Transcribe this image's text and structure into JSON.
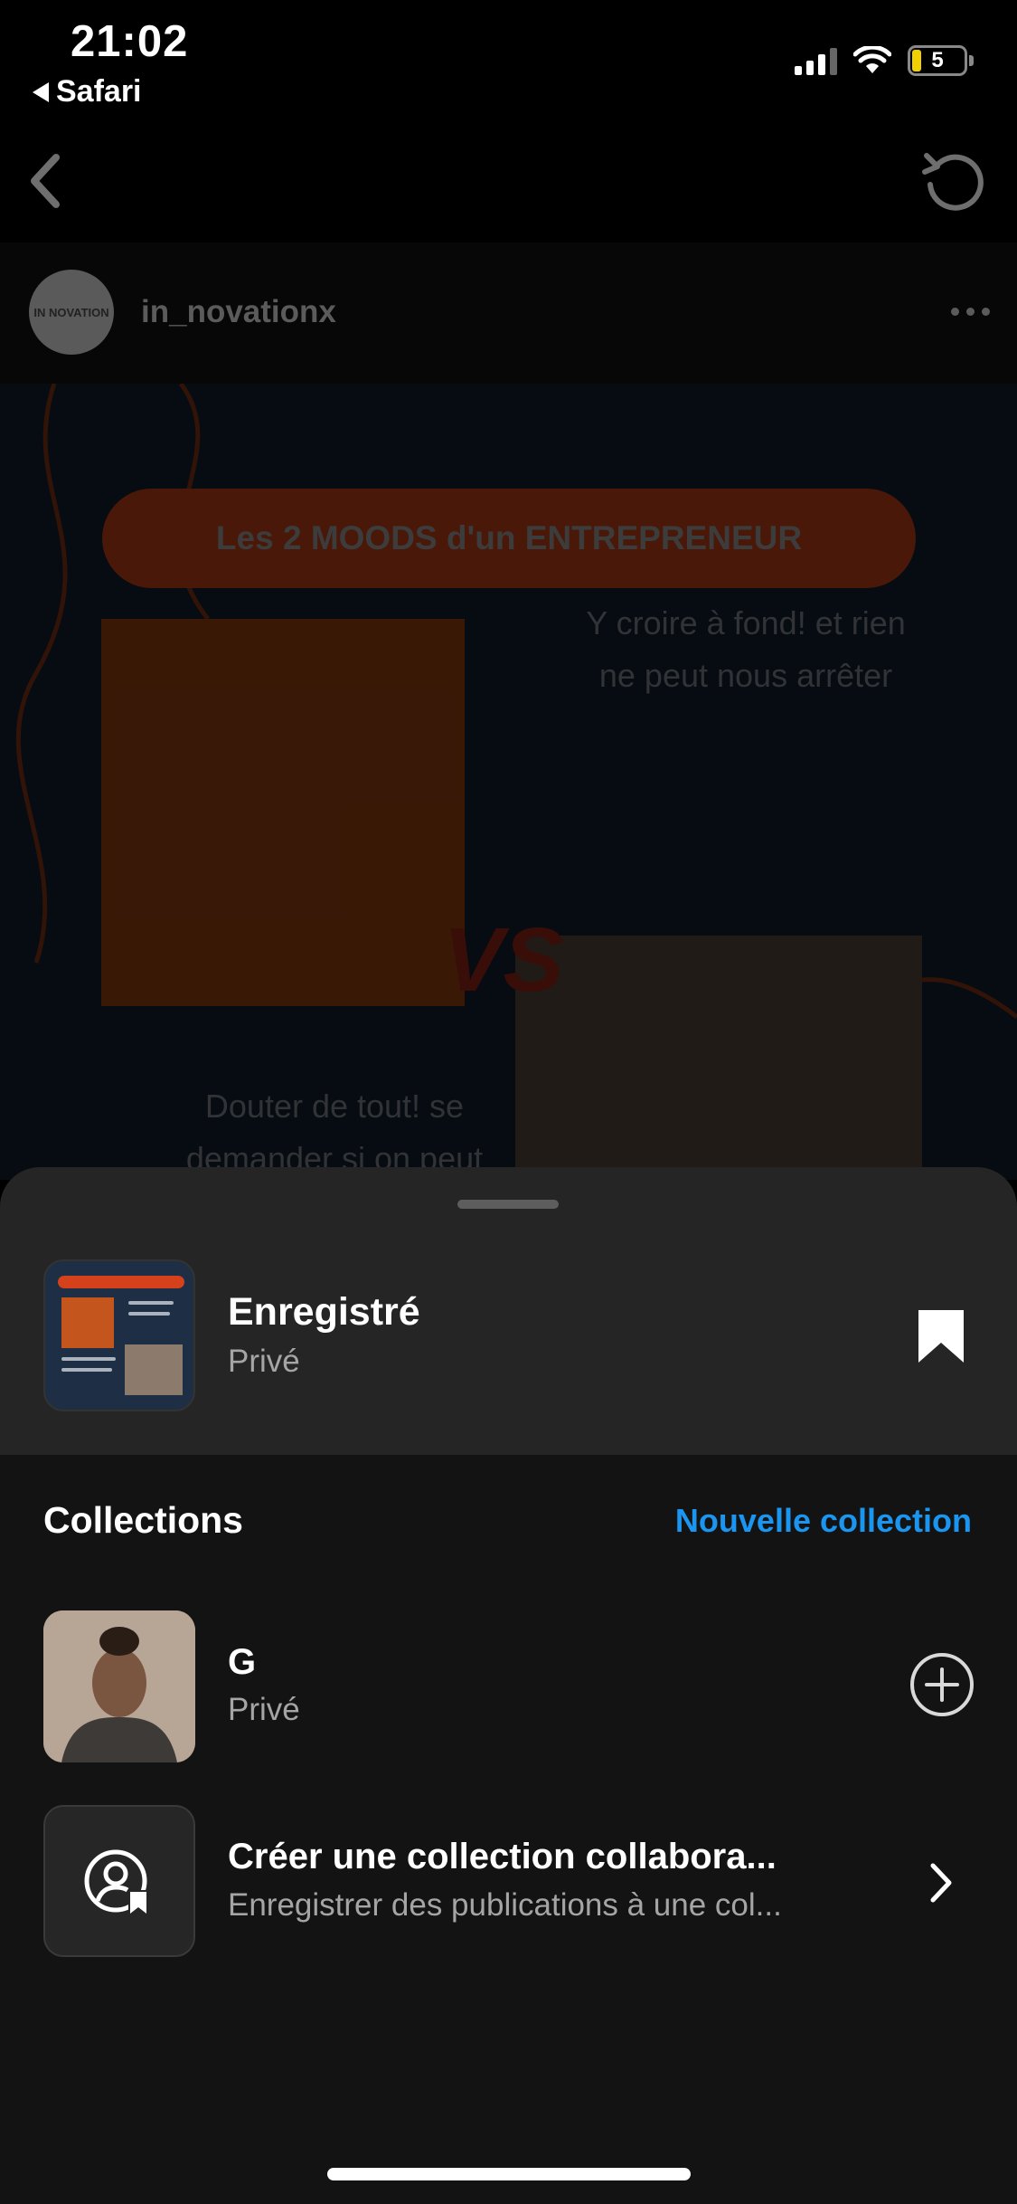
{
  "status_bar": {
    "time": "21:02",
    "back_app": "Safari",
    "battery": "5"
  },
  "post": {
    "username": "in_novationx",
    "avatar_text": "IN NOVATION",
    "image": {
      "title": "Les 2 MOODS d'un ENTREPRENEUR",
      "text_top": "Y croire à fond! et rien ne peut nous arrêter",
      "text_bottom": "Douter de tout! se demander si on peut",
      "vs": "VS"
    }
  },
  "sheet": {
    "saved": {
      "title": "Enregistré",
      "subtitle": "Privé"
    },
    "collections_heading": "Collections",
    "new_collection_label": "Nouvelle collection",
    "collections": [
      {
        "name": "G",
        "subtitle": "Privé"
      }
    ],
    "collab": {
      "title": "Créer une collection collabora...",
      "subtitle": "Enregistrer des publications à une col..."
    }
  },
  "colors": {
    "accent": "#1a96f0",
    "sheet_bg": "#131313",
    "sheet_header_bg": "#252525"
  },
  "icons": [
    "back-arrow-icon",
    "refresh-icon",
    "more-icon",
    "bookmark-icon",
    "plus-circle-icon",
    "collab-user-icon",
    "chevron-right-icon"
  ]
}
